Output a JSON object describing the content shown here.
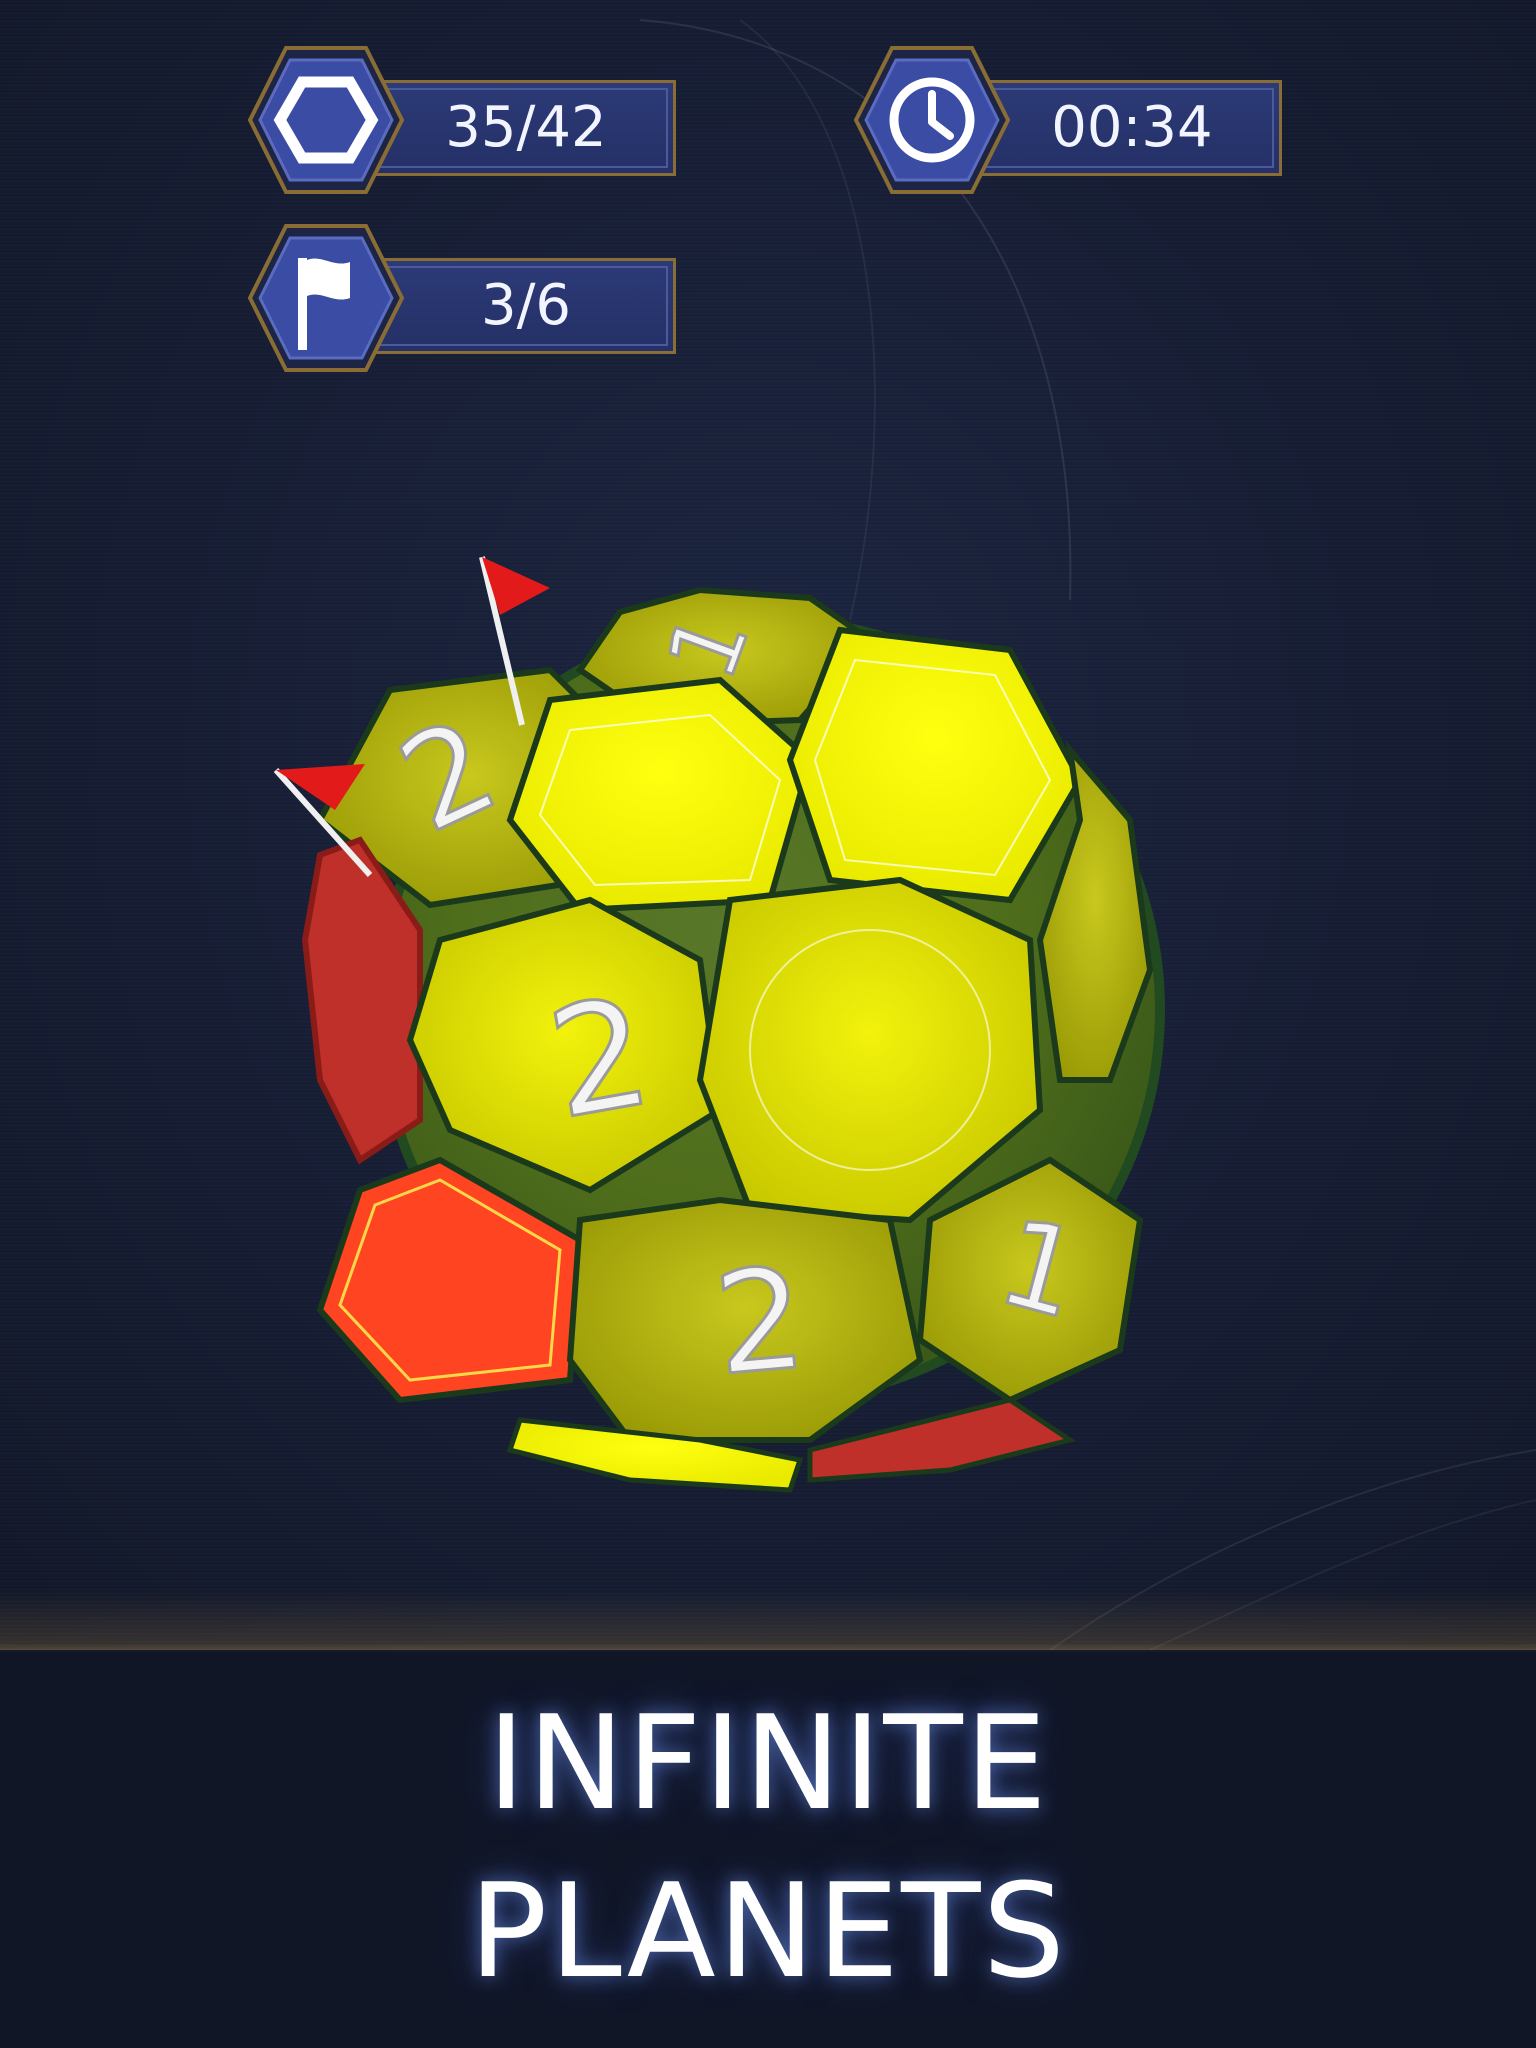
{
  "hud": {
    "blocks": {
      "value": "35/42",
      "icon": "hexagon-icon"
    },
    "timer": {
      "value": "00:34",
      "icon": "clock-icon"
    },
    "flags": {
      "value": "3/6",
      "icon": "flag-icon"
    }
  },
  "planet": {
    "tile_numbers": [
      "1",
      "2",
      "2",
      "2",
      "1"
    ]
  },
  "banner": {
    "line1": "INFINITE",
    "line2": "PLANETS"
  },
  "colors": {
    "background": "#141b2e",
    "hud_fill": "#2c3a77",
    "hud_border": "#8a6d35",
    "tile_yellow": "#e6e60e",
    "tile_red": "#d0322a",
    "flag_red": "#e31a1a"
  }
}
